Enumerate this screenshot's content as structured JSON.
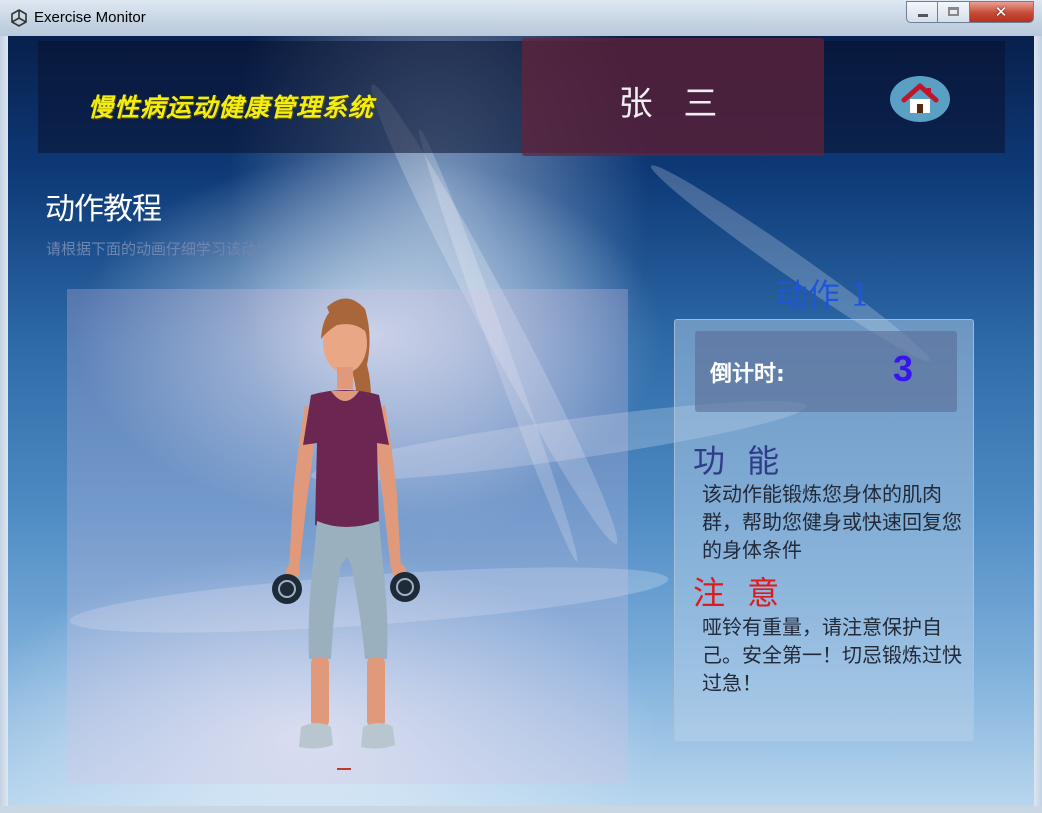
{
  "window": {
    "title": "Exercise Monitor",
    "close_glyph": "✕",
    "icons": [
      "app-icon",
      "minimize-icon",
      "maximize-icon",
      "close-icon"
    ]
  },
  "header": {
    "system_title": "慢性病运动健康管理系统",
    "user_name": "张 三",
    "home_icon": "home-icon"
  },
  "tutorial": {
    "title": "动作教程",
    "subtitle": "请根据下面的动画仔细学习该动作"
  },
  "action": {
    "title": "动作 1",
    "countdown_label": "倒计时:",
    "countdown_value": "3",
    "function_heading": "功 能",
    "function_text": "该动作能锻炼您身体的肌肉群，帮助您健身或快速回复您的身体条件",
    "notice_heading": "注 意",
    "notice_text": "哑铃有重量，请注意保护自己。安全第一！切忌锻炼过快过急！"
  },
  "colors": {
    "system_title": "#f4ee10",
    "user_panel": "#64223a",
    "action_title": "#1f56d8",
    "countdown_value": "#3714f0",
    "function_heading": "#2e3d88",
    "notice_heading": "#e0191e"
  }
}
